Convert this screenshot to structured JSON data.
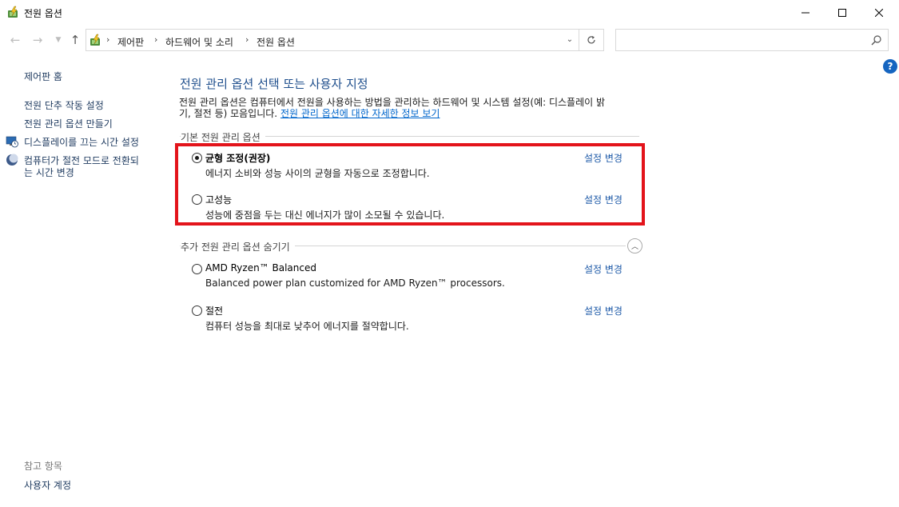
{
  "window": {
    "title": "전원 옵션"
  },
  "nav": {
    "breadcrumbs": [
      "제어판",
      "하드웨어 및 소리",
      "전원 옵션"
    ],
    "search_placeholder": ""
  },
  "sidebar": {
    "home_link": "제어판 홈",
    "links": [
      {
        "label": "전원 단추 작동 설정"
      },
      {
        "label": "전원 관리 옵션 만들기"
      },
      {
        "label": "디스플레이를 끄는 시간 설정",
        "icon": "display-clock-icon"
      },
      {
        "label_line1": "컴퓨터가 절전 모드로 전환되",
        "label_line2": "는 시간 변경",
        "icon": "sleep-moon-icon"
      }
    ],
    "see_also_heading": "참고 항목",
    "see_also_links": [
      "사용자 계정"
    ]
  },
  "main": {
    "title": "전원 관리 옵션 선택 또는 사용자 지정",
    "desc_line1": "전원 관리 옵션은 컴퓨터에서 전원을 사용하는 방법을 관리하는 하드웨어 및 시스템 설정(예: 디스플레이 밝",
    "desc_line2": "기, 절전 등) 모음입니다. ",
    "desc_link": "전원 관리 옵션에 대한 자세한 정보 보기",
    "preferred_group_label": "기본 전원 관리 옵션",
    "additional_group_label": "추가 전원 관리 옵션 숨기기",
    "change_settings_label": "설정 변경",
    "preferred_plans": [
      {
        "name": "균형 조정(권장)",
        "desc": "에너지 소비와 성능 사이의 균형을 자동으로 조정합니다.",
        "selected": true
      },
      {
        "name": "고성능",
        "desc": "성능에 중점을 두는 대신 에너지가 많이 소모될 수 있습니다.",
        "selected": false
      }
    ],
    "additional_plans": [
      {
        "name": "AMD Ryzen™ Balanced",
        "desc": "Balanced power plan customized for AMD Ryzen™ processors.",
        "selected": false
      },
      {
        "name": "절전",
        "desc": "컴퓨터 성능을 최대로 낮추어 에너지를 절약합니다.",
        "selected": false
      }
    ]
  },
  "colors": {
    "highlight_border": "#e3141b",
    "title_blue": "#1e4e8c",
    "link_blue": "#1e5aa8"
  }
}
